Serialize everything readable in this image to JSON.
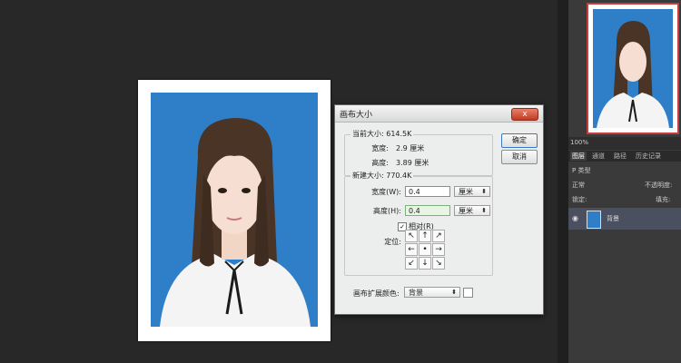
{
  "dialog": {
    "title": "画布大小",
    "close_label": "x",
    "current": {
      "legend": "当前大小: 614.5K",
      "width_label": "宽度:",
      "width_value": "2.9 厘米",
      "height_label": "高度:",
      "height_value": "3.89 厘米"
    },
    "new": {
      "legend": "新建大小: 770.4K",
      "width_label": "宽度(W):",
      "width_value": "0.4",
      "width_unit": "厘米",
      "height_label": "高度(H):",
      "height_value": "0.4",
      "height_unit": "厘米",
      "relative_label": "相对(R)",
      "relative_checked": true,
      "anchor_label": "定位:"
    },
    "ext_color_label": "画布扩展颜色:",
    "ext_color_value": "背景",
    "ok_label": "确定",
    "cancel_label": "取消",
    "anchor_cells": [
      "↖",
      "↑",
      "↗",
      "←",
      "•",
      "→",
      "↙",
      "↓",
      "↘"
    ]
  },
  "panel": {
    "zoom": "100%",
    "tabs": [
      "图层",
      "通道",
      "路径",
      "历史记录"
    ],
    "filter_label": "P 类型",
    "blend_mode": "正常",
    "opacity_label": "不透明度:",
    "lock_label": "锁定:",
    "fill_label": "填充:",
    "layer_name": "背景"
  },
  "colors": {
    "photo_bg": "#2f7ec8",
    "nav_border": "#c73b3b",
    "input_active": "#e8f5e4"
  }
}
